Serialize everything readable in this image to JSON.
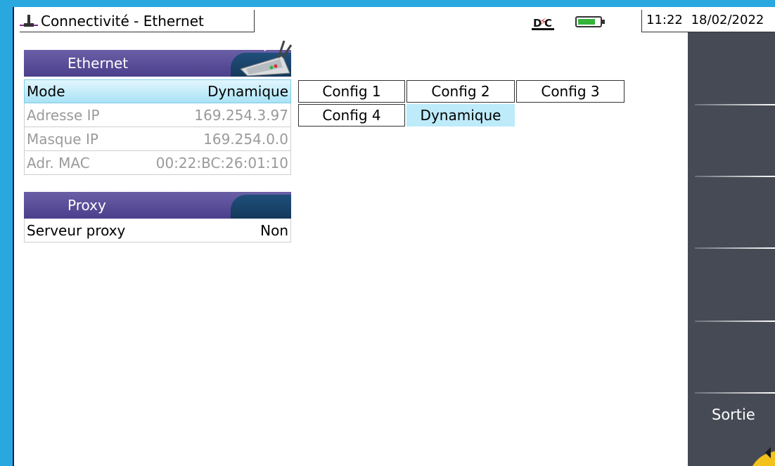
{
  "window": {
    "title": "Connectivité - Ethernet",
    "time": "11:22",
    "date": "18/02/2022",
    "status_icon": "dc-power-icon",
    "battery_level": 0.8
  },
  "ethernet": {
    "header": "Ethernet",
    "rows": [
      {
        "label": "Mode",
        "value": "Dynamique"
      },
      {
        "label": "Adresse IP",
        "value": "169.254.3.97"
      },
      {
        "label": "Masque IP",
        "value": "169.254.0.0"
      },
      {
        "label": "Adr. MAC",
        "value": "00:22:BC:26:01:10"
      }
    ]
  },
  "mode_options": [
    "Config 1",
    "Config 2",
    "Config 3",
    "Config 4",
    "Dynamique"
  ],
  "mode_selected": "Dynamique",
  "proxy": {
    "header": "Proxy",
    "rows": [
      {
        "label": "Serveur proxy",
        "value": "Non"
      }
    ]
  },
  "side_menu": {
    "items": [
      "",
      "",
      "",
      "",
      "",
      "Sortie"
    ]
  },
  "colors": {
    "frame": "#29a8e0",
    "header": "#4b3f8c",
    "selection": "#bdebf9",
    "side_menu": "#464a55"
  }
}
